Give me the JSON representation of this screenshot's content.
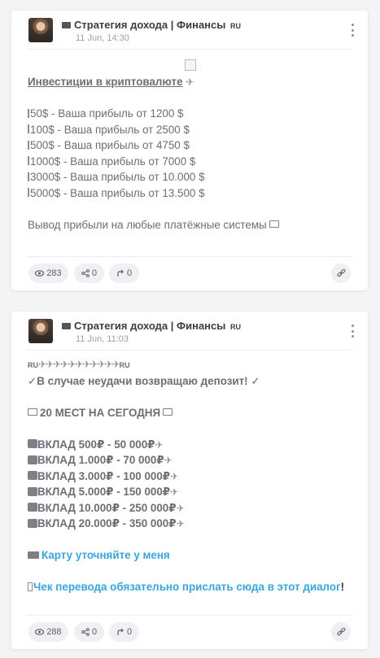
{
  "posts": [
    {
      "channel": "Стратегия дохода | Финансы",
      "lang": "RU",
      "date": "11 Jun, 14:30",
      "heading": "Инвестиции в криптовалюте",
      "tiers": [
        "50$ - Ваша прибыль от 1200 $",
        "100$ - Ваша прибыль от 2500 $",
        "500$ - Ваша прибыль от 4750 $",
        "1000$ - Ваша прибыль от 7000 $",
        "3000$ - Ваша прибыль от 10.000 $",
        "5000$ - Ваша прибыль от 13.500 $"
      ],
      "withdraw_text": "Вывод прибыли на любые платёжные системы",
      "views": "283",
      "shares": "0",
      "forwards": "0"
    },
    {
      "channel": "Стратегия дохода | Финансы",
      "lang": "RU",
      "date": "11 Jun, 11:03",
      "ru_start": "RU",
      "ru_end": "RU",
      "guarantee": "✓В случае неудачи возвращаю депозит! ✓",
      "seats": "20 МЕСТ НА СЕГОДНЯ",
      "deposits": [
        "ВКЛАД 500₽ - 50 000₽",
        "ВКЛАД 1.000₽ - 70 000₽",
        "ВКЛАД 3.000₽ - 100 000₽",
        "ВКЛАД 5.000₽ - 150 000₽",
        "ВКЛАД 10.000₽ - 250 000₽",
        "ВКЛАД 20.000₽ - 350 000₽"
      ],
      "card_text": "Карту уточняйте у меня",
      "receipt_text": "Чек перевода обязательно прислать сюда в этот диалог",
      "receipt_end": "!",
      "views": "288",
      "shares": "0",
      "forwards": "0"
    }
  ],
  "icons": {
    "views": "eye-icon",
    "shares": "share-icon",
    "forwards": "forward-icon",
    "link": "link-icon",
    "menu": "kebab-menu-icon"
  },
  "colors": {
    "accent_link": "#37a6dc",
    "text": "#6b6e75",
    "background": "#f3f4f6"
  }
}
